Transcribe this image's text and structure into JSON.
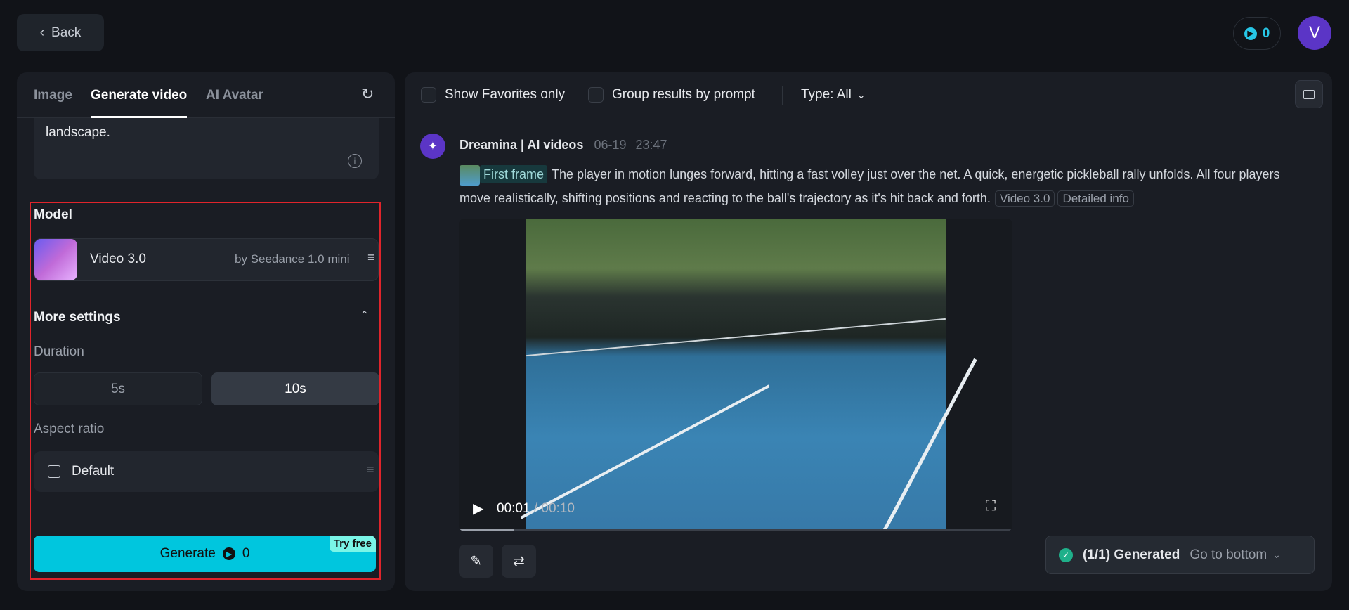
{
  "header": {
    "back_label": "Back",
    "credits": "0",
    "avatar_letter": "V"
  },
  "left_panel": {
    "tabs": [
      {
        "label": "Image"
      },
      {
        "label": "Generate video"
      },
      {
        "label": "AI Avatar"
      }
    ],
    "prompt_tail": "landscape.",
    "model_label": "Model",
    "model": {
      "name": "Video 3.0",
      "provider": "by Seedance 1.0 mini"
    },
    "more_settings_label": "More settings",
    "duration_label": "Duration",
    "durations": [
      {
        "label": "5s",
        "selected": false
      },
      {
        "label": "10s",
        "selected": true
      }
    ],
    "aspect_label": "Aspect ratio",
    "aspect_value": "Default",
    "generate_label": "Generate",
    "generate_cost": "0",
    "try_free": "Try free"
  },
  "toolbar": {
    "show_favorites": "Show Favorites only",
    "group_results": "Group results by prompt",
    "type_filter": "Type: All"
  },
  "result": {
    "author": "Dreamina | AI videos",
    "date": "06-19",
    "time": "23:47",
    "first_frame_label": "First frame",
    "prompt": "The player in motion lunges forward, hitting a fast volley just over the net. A quick, energetic pickleball rally unfolds. All four players move realistically, shifting positions and reacting to the ball's trajectory as it's hit back and forth.",
    "model_tag": "Video 3.0",
    "detail_tag": "Detailed info",
    "current_time": "00:01",
    "duration": "00:10",
    "progress": 0.1
  },
  "status": {
    "generated": "(1/1) Generated",
    "go_bottom": "Go to bottom"
  },
  "colors": {
    "accent": "#00c6de",
    "highlight": "#e0242b",
    "avatar": "#5b35c6"
  }
}
